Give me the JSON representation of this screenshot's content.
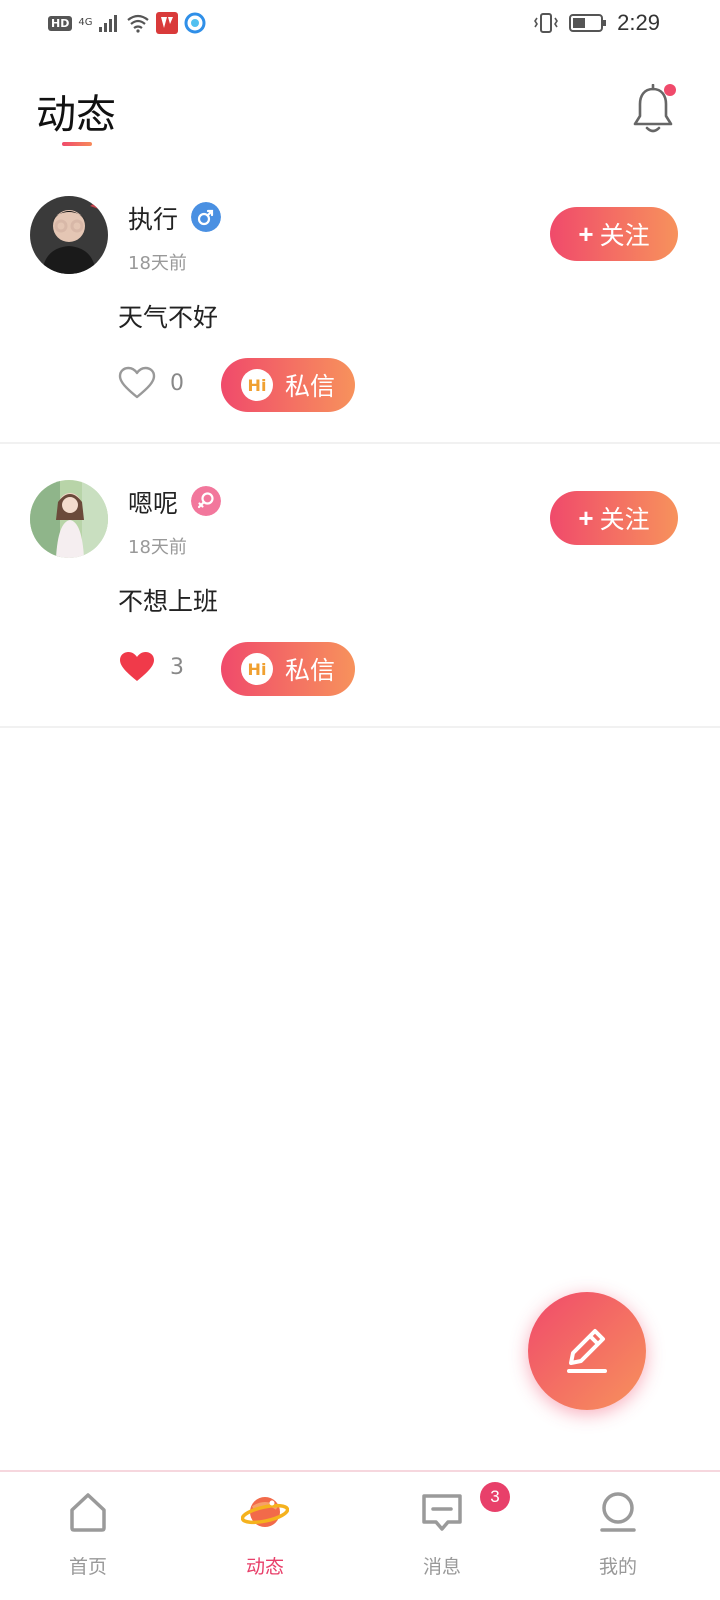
{
  "status_bar": {
    "hd": "HD",
    "net": "4G",
    "time": "2:29"
  },
  "header": {
    "title": "动态"
  },
  "posts": [
    {
      "username": "执行",
      "gender": "male",
      "time": "18天前",
      "content": "天气不好",
      "liked": false,
      "like_count": "0",
      "follow_label": "关注",
      "follow_plus": "+",
      "message_label": "私信",
      "hi_label": "Hi"
    },
    {
      "username": "嗯呢",
      "gender": "female",
      "time": "18天前",
      "content": "不想上班",
      "liked": true,
      "like_count": "3",
      "follow_label": "关注",
      "follow_plus": "+",
      "message_label": "私信",
      "hi_label": "Hi"
    }
  ],
  "nav": {
    "home": "首页",
    "moments": "动态",
    "messages": "消息",
    "mine": "我的",
    "messages_badge": "3",
    "active": "moments"
  },
  "colors": {
    "accent_start": "#f04a6b",
    "accent_end": "#f7925c",
    "male": "#4a90e2",
    "female": "#f2779c",
    "like_active": "#f03a4a"
  }
}
